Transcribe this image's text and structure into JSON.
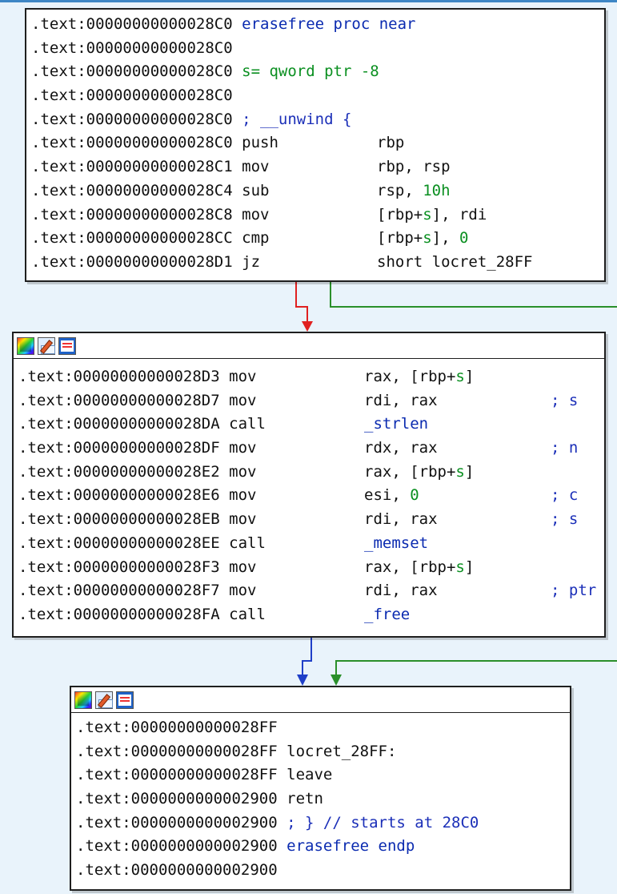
{
  "colors": {
    "background": "#e9f3fb",
    "block_bg": "#ffffff",
    "function_name": "#0b2bb0",
    "number": "#0a8f20",
    "comment": "#1b2fb8",
    "edge_true": "#2a8f2a",
    "edge_false": "#e02020",
    "edge_normal": "#1f3fc8"
  },
  "toolbar_icons": [
    "color-palette-icon",
    "edit-pencil-icon",
    "graph-overview-icon"
  ],
  "block1": {
    "lines": [
      {
        "addr": ".text:00000000000028C0",
        "text": "erasefree proc near"
      },
      {
        "addr": ".text:00000000000028C0",
        "text": ""
      },
      {
        "addr": ".text:00000000000028C0",
        "text": "s= qword ptr -8"
      },
      {
        "addr": ".text:00000000000028C0",
        "text": ""
      },
      {
        "addr": ".text:00000000000028C0",
        "text": "; __unwind {"
      },
      {
        "addr": ".text:00000000000028C0",
        "mnem": "push",
        "ops": "rbp"
      },
      {
        "addr": ".text:00000000000028C1",
        "mnem": "mov",
        "ops": "rbp, rsp"
      },
      {
        "addr": ".text:00000000000028C4",
        "mnem": "sub",
        "ops": "rsp, 10h"
      },
      {
        "addr": ".text:00000000000028C8",
        "mnem": "mov",
        "ops": "[rbp+s], rdi"
      },
      {
        "addr": ".text:00000000000028CC",
        "mnem": "cmp",
        "ops": "[rbp+s], 0"
      },
      {
        "addr": ".text:00000000000028D1",
        "mnem": "jz",
        "ops": "short locret_28FF"
      }
    ]
  },
  "block2": {
    "lines": [
      {
        "addr": ".text:00000000000028D3",
        "mnem": "mov",
        "ops": "rax, [rbp+s]",
        "cmt": ""
      },
      {
        "addr": ".text:00000000000028D7",
        "mnem": "mov",
        "ops": "rdi, rax",
        "cmt": "; s"
      },
      {
        "addr": ".text:00000000000028DA",
        "mnem": "call",
        "ops": "_strlen",
        "cmt": ""
      },
      {
        "addr": ".text:00000000000028DF",
        "mnem": "mov",
        "ops": "rdx, rax",
        "cmt": "; n"
      },
      {
        "addr": ".text:00000000000028E2",
        "mnem": "mov",
        "ops": "rax, [rbp+s]",
        "cmt": ""
      },
      {
        "addr": ".text:00000000000028E6",
        "mnem": "mov",
        "ops": "esi, 0",
        "cmt": "; c"
      },
      {
        "addr": ".text:00000000000028EB",
        "mnem": "mov",
        "ops": "rdi, rax",
        "cmt": "; s"
      },
      {
        "addr": ".text:00000000000028EE",
        "mnem": "call",
        "ops": "_memset",
        "cmt": ""
      },
      {
        "addr": ".text:00000000000028F3",
        "mnem": "mov",
        "ops": "rax, [rbp+s]",
        "cmt": ""
      },
      {
        "addr": ".text:00000000000028F7",
        "mnem": "mov",
        "ops": "rdi, rax",
        "cmt": "; ptr"
      },
      {
        "addr": ".text:00000000000028FA",
        "mnem": "call",
        "ops": "_free",
        "cmt": ""
      }
    ]
  },
  "block3": {
    "lines": [
      {
        "addr": ".text:00000000000028FF",
        "text": ""
      },
      {
        "addr": ".text:00000000000028FF",
        "text": "locret_28FF:"
      },
      {
        "addr": ".text:00000000000028FF",
        "text": "leave"
      },
      {
        "addr": ".text:0000000000002900",
        "text": "retn"
      },
      {
        "addr": ".text:0000000000002900",
        "text": "; } // starts at 28C0"
      },
      {
        "addr": ".text:0000000000002900",
        "text": "erasefree endp"
      },
      {
        "addr": ".text:0000000000002900",
        "text": ""
      }
    ]
  }
}
